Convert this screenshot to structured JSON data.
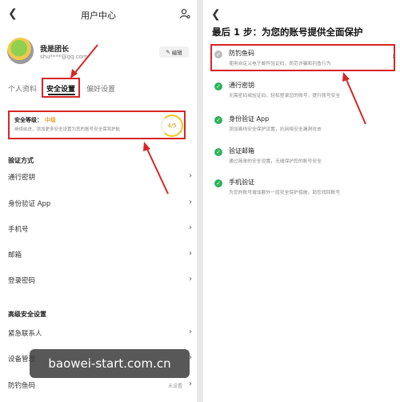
{
  "left": {
    "header": {
      "title": "用户中心",
      "back_icon": "chevron-left-icon",
      "user_icon": "user-settings-icon"
    },
    "profile": {
      "name": "我是团长",
      "email": "shu****@qq.com",
      "edit_label": "编辑",
      "edit_icon": "edit-icon"
    },
    "tabs": [
      {
        "label": "个人资料",
        "active": false
      },
      {
        "label": "安全设置",
        "active": true
      },
      {
        "label": "偏好设置",
        "active": false
      }
    ],
    "security": {
      "level_label": "安全等级：",
      "level_value": "中级",
      "description": "继续前进，添加更多安全设置为您的账号安全保驾护航",
      "score": "4/5"
    },
    "verification": {
      "title": "验证方式",
      "items": [
        {
          "label": "通行密钥"
        },
        {
          "label": "身份验证 App"
        },
        {
          "label": "手机号"
        },
        {
          "label": "邮箱"
        },
        {
          "label": "登录密码"
        }
      ]
    },
    "advanced": {
      "title": "高级安全设置",
      "items": [
        {
          "label": "紧急联系人"
        },
        {
          "label": "设备管理"
        },
        {
          "label": "防钓鱼码",
          "status": "未设置"
        }
      ]
    },
    "watermark": "baowei-start.com.cn"
  },
  "right": {
    "back_icon": "chevron-left-icon",
    "title": "最后 1 步：为您的账号提供全面保护",
    "items": [
      {
        "name": "防钓鱼码",
        "desc": "使用自定义电子邮件验证码，防范诈骗和钓鱼行为",
        "done": false
      },
      {
        "name": "通行密钥",
        "desc": "无需密码或验证码，轻松登录您的账号，提升账号安全",
        "done": true
      },
      {
        "name": "身份验证 App",
        "desc": "添加离线安全保护设置，抗网络安全漏洞攻击",
        "done": true
      },
      {
        "name": "验证邮箱",
        "desc": "通过简单的安全设置，无缝保护您的账号安全",
        "done": true
      },
      {
        "name": "手机验证",
        "desc": "为您的账号增加额外一层安全保护措施，助您找回账号",
        "done": true
      }
    ]
  },
  "colors": {
    "highlight": "#d72626",
    "check": "#2fb25a",
    "level": "#e6a23c"
  }
}
